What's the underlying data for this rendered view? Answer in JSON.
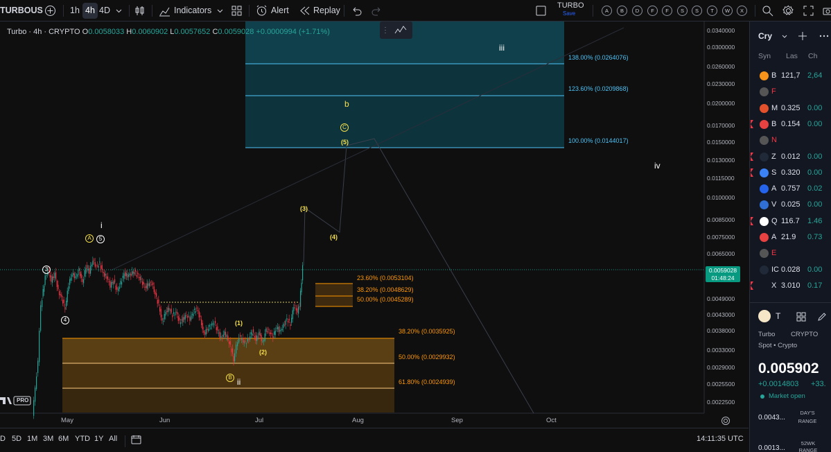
{
  "toolbar": {
    "symbol": "TURBOUS",
    "intervals": [
      "1h",
      "4h",
      "4D"
    ],
    "active_interval": "4h",
    "indicators_label": "Indicators",
    "alert_label": "Alert",
    "replay_label": "Replay",
    "layout_name": "TURBO",
    "save_label": "Save",
    "letter_buttons": [
      "A",
      "B",
      "D",
      "F",
      "F",
      "S",
      "S",
      "T",
      "W",
      "X"
    ]
  },
  "legend": {
    "title": "Turbo · 4h · CRYPTO",
    "o_label": "O",
    "o": "0.0058033",
    "h_label": "H",
    "h": "0.0060902",
    "l_label": "L",
    "l": "0.0057652",
    "c_label": "C",
    "c": "0.0059028",
    "change": "+0.0000994 (+1.71%)"
  },
  "fib_upper": [
    {
      "label": "138.00% (0.0264076)"
    },
    {
      "label": "123.60% (0.0209868)"
    },
    {
      "label": "100.00% (0.0144017)"
    }
  ],
  "fib_middle": [
    {
      "label": "23.60% (0.0053104)"
    },
    {
      "label": "38.20% (0.0048629)"
    },
    {
      "label": "50.00% (0.0045289)"
    }
  ],
  "fib_lower": [
    {
      "label": "38.20% (0.0035925)"
    },
    {
      "label": "50.00% (0.0029932)"
    },
    {
      "label": "61.80% (0.0024939)"
    }
  ],
  "waves": {
    "iii": "iii",
    "b": "b",
    "C": "C",
    "w5": "(5)",
    "iv": "iv",
    "w3": "(3)",
    "w4": "(4)",
    "i": "i",
    "A": "A",
    "c5": "5",
    "c3": "3",
    "c4": "4",
    "w1": "(1)",
    "w2": "(2)",
    "B": "B",
    "ii": "ii"
  },
  "price_axis": [
    "0.0340000",
    "0.0300000",
    "0.0260000",
    "0.0230000",
    "0.0200000",
    "0.0170000",
    "0.0150000",
    "0.0130000",
    "0.0115000",
    "0.0100000",
    "0.0085000",
    "0.0075000",
    "0.0065000",
    "0.0049000",
    "0.0043000",
    "0.0038000",
    "0.0033000",
    "0.0029000",
    "0.0025500",
    "0.0022500"
  ],
  "current_price": {
    "price": "0.0059028",
    "countdown": "01:48:24"
  },
  "date_axis": [
    "May",
    "Jun",
    "Jul",
    "Aug",
    "Sep",
    "Oct"
  ],
  "bottom": {
    "ranges": [
      "D",
      "5D",
      "1M",
      "3M",
      "6M",
      "YTD",
      "1Y",
      "All"
    ],
    "time": "14:11:35 UTC"
  },
  "watchlist": {
    "title": "Cry",
    "cols": [
      "Syn",
      "Las",
      "Ch"
    ],
    "rows": [
      {
        "sym": "B",
        "last": "121,7",
        "chg": "2,64",
        "color": "#f7931a",
        "flag": false,
        "chg_red": false
      },
      {
        "sym": "F",
        "last": "",
        "chg": "",
        "color": "#555555",
        "flag": false,
        "chg_red": false,
        "sym_red": true
      },
      {
        "sym": "M",
        "last": "0.325",
        "chg": "0.00",
        "color": "#e2502c",
        "flag": false,
        "chg_red": false
      },
      {
        "sym": "B",
        "last": "0.154",
        "chg": "0.00",
        "color": "#e84142",
        "flag": true,
        "chg_red": false
      },
      {
        "sym": "N",
        "last": "",
        "chg": "",
        "color": "#555555",
        "flag": false,
        "chg_red": false,
        "sym_red": true
      },
      {
        "sym": "Z",
        "last": "0.012",
        "chg": "0.00",
        "color": "#1f2937",
        "flag": true,
        "chg_red": false
      },
      {
        "sym": "S",
        "last": "0.320",
        "chg": "0.00",
        "color": "#3b82f6",
        "flag": true,
        "chg_red": false
      },
      {
        "sym": "A",
        "last": "0.757",
        "chg": "0.02",
        "color": "#2563eb",
        "flag": false,
        "chg_red": false
      },
      {
        "sym": "V",
        "last": "0.025",
        "chg": "0.00",
        "color": "#2f6fd6",
        "flag": false,
        "chg_red": false
      },
      {
        "sym": "Q",
        "last": "116.7",
        "chg": "1.46",
        "color": "#ffffff",
        "flag": true,
        "chg_red": false
      },
      {
        "sym": "A",
        "last": "21.9",
        "chg": "0.73",
        "color": "#e84142",
        "flag": false,
        "chg_red": false
      },
      {
        "sym": "E",
        "last": "",
        "chg": "",
        "color": "#555555",
        "flag": false,
        "chg_red": false,
        "sym_red": true
      },
      {
        "sym": "IC",
        "last": "0.028",
        "chg": "0.00",
        "color": "#1f2937",
        "flag": false,
        "chg_red": false
      },
      {
        "sym": "X",
        "last": "3.010",
        "chg": "0.17",
        "color": "#131722",
        "flag": true,
        "chg_red": false
      }
    ]
  },
  "detail": {
    "name": "T",
    "exchange": "Turbo",
    "exchange_suffix": "CRYPTO",
    "category": "Spot • Crypto",
    "price": "0.005902",
    "change": "+0.0014803",
    "change_pct": "+33.",
    "market_status": "Market open",
    "low_value": "0.0043...",
    "range_label": "DAY'S RANGE",
    "wk_low_value": "0.0013...",
    "wk_label": "52WK RANGE"
  },
  "colors": {
    "up": "#26a69a",
    "down": "#f23645",
    "fib_upper": "#2196f3",
    "fib_orange": "#ff9800",
    "wave_yellow": "#f5e04a"
  }
}
